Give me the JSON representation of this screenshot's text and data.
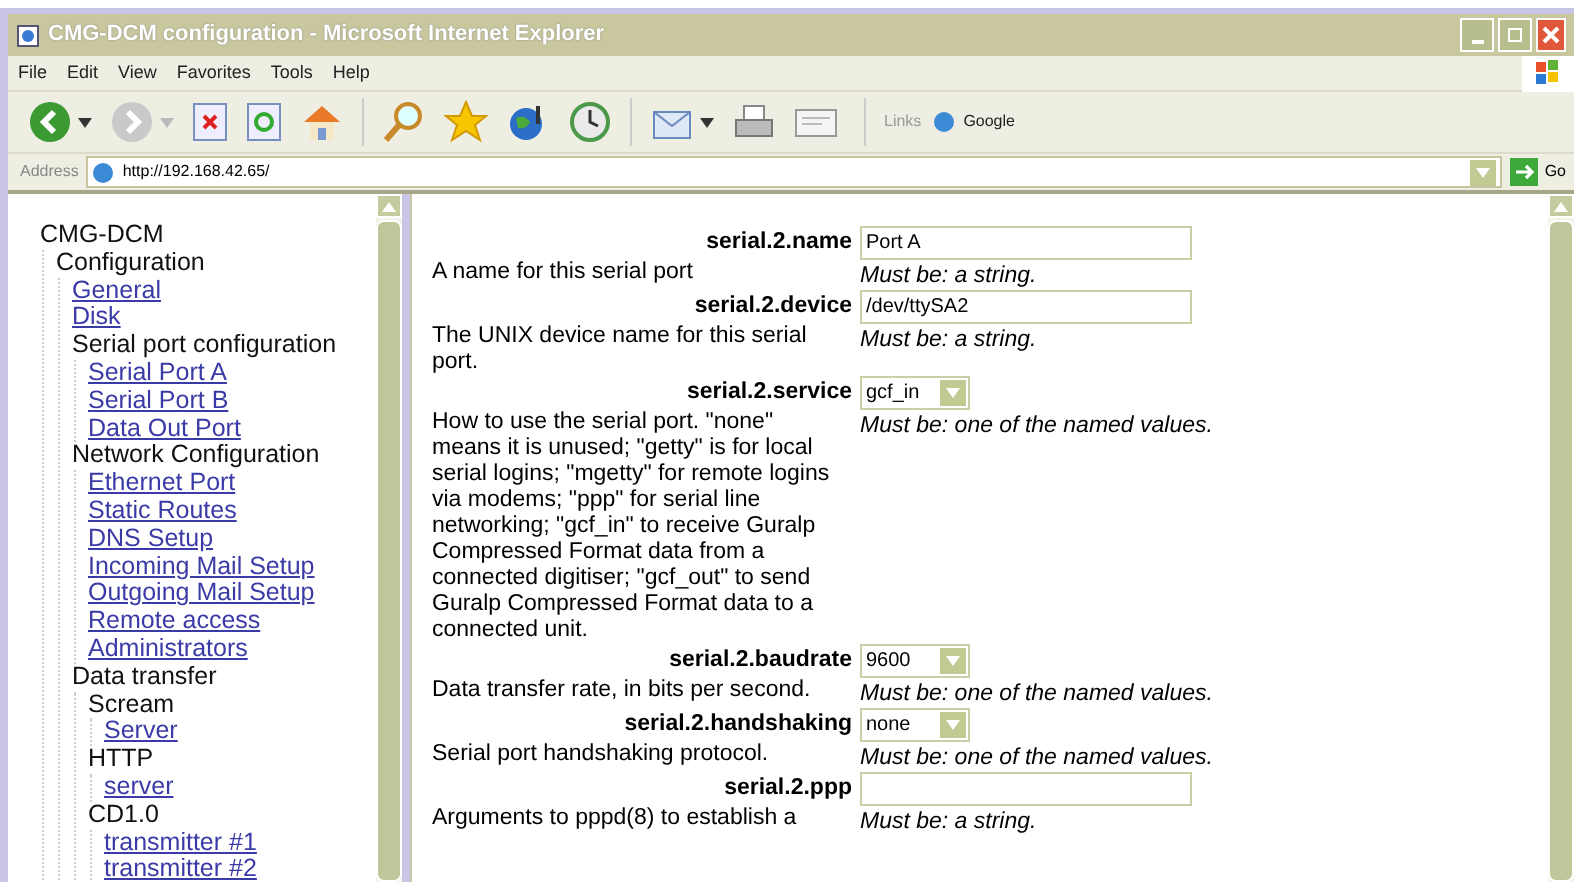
{
  "window": {
    "title": "CMG-DCM configuration - Microsoft Internet Explorer"
  },
  "menu": [
    "File",
    "Edit",
    "View",
    "Favorites",
    "Tools",
    "Help"
  ],
  "links_bar": {
    "label": "Links",
    "items": [
      "Google"
    ]
  },
  "address_bar": {
    "label": "Address",
    "url": "http://192.168.42.65/",
    "go": "Go"
  },
  "tree": [
    {
      "label": "CMG-DCM",
      "kind": "heading",
      "children": [
        {
          "label": "Configuration",
          "kind": "heading",
          "children": [
            {
              "label": "General",
              "kind": "link"
            },
            {
              "label": "Disk",
              "kind": "link"
            },
            {
              "label": "Serial port configuration",
              "kind": "heading",
              "children": [
                {
                  "label": "Serial Port A",
                  "kind": "link"
                },
                {
                  "label": "Serial Port B",
                  "kind": "link"
                },
                {
                  "label": "Data Out Port",
                  "kind": "link"
                }
              ]
            },
            {
              "label": "Network Configuration",
              "kind": "heading",
              "children": [
                {
                  "label": "Ethernet Port",
                  "kind": "link"
                },
                {
                  "label": "Static Routes",
                  "kind": "link"
                },
                {
                  "label": "DNS Setup",
                  "kind": "link"
                },
                {
                  "label": "Incoming Mail Setup",
                  "kind": "link"
                },
                {
                  "label": "Outgoing Mail Setup",
                  "kind": "link"
                },
                {
                  "label": "Remote access",
                  "kind": "link"
                },
                {
                  "label": "Administrators",
                  "kind": "link"
                }
              ]
            },
            {
              "label": "Data transfer",
              "kind": "heading",
              "children": [
                {
                  "label": "Scream",
                  "kind": "heading",
                  "children": [
                    {
                      "label": "Server",
                      "kind": "link"
                    }
                  ]
                },
                {
                  "label": "HTTP",
                  "kind": "heading",
                  "children": [
                    {
                      "label": "server",
                      "kind": "link"
                    }
                  ]
                },
                {
                  "label": "CD1.0",
                  "kind": "heading",
                  "children": [
                    {
                      "label": "transmitter #1",
                      "kind": "link"
                    },
                    {
                      "label": "transmitter #2",
                      "kind": "link"
                    }
                  ]
                }
              ]
            }
          ]
        }
      ]
    }
  ],
  "fields": [
    {
      "label": "serial.2.name",
      "kind": "text",
      "value": "Port A",
      "description": "A name for this serial port",
      "hint": "Must be: a string."
    },
    {
      "label": "serial.2.device",
      "kind": "text",
      "value": "/dev/ttySA2",
      "description": "The UNIX device name for this serial port.",
      "hint": "Must be: a string."
    },
    {
      "label": "serial.2.service",
      "kind": "select",
      "value": "gcf_in",
      "description": "How to use the serial port. \"none\" means it is unused; \"getty\" is for local serial logins; \"mgetty\" for remote logins via modems; \"ppp\" for serial line networking; \"gcf_in\" to receive Guralp Compressed Format data from a connected digitiser; \"gcf_out\" to send Guralp Compressed Format data to a connected unit.",
      "hint": "Must be: one of the named values."
    },
    {
      "label": "serial.2.baudrate",
      "kind": "select",
      "value": "9600",
      "description": "Data transfer rate, in bits per second.",
      "hint": "Must be: one of the named values."
    },
    {
      "label": "serial.2.handshaking",
      "kind": "select",
      "value": "none",
      "description": "Serial port handshaking protocol.",
      "hint": "Must be: one of the named values."
    },
    {
      "label": "serial.2.ppp",
      "kind": "text",
      "description": "Arguments to pppd(8) to establish a",
      "hint": "Must be: a string."
    }
  ]
}
